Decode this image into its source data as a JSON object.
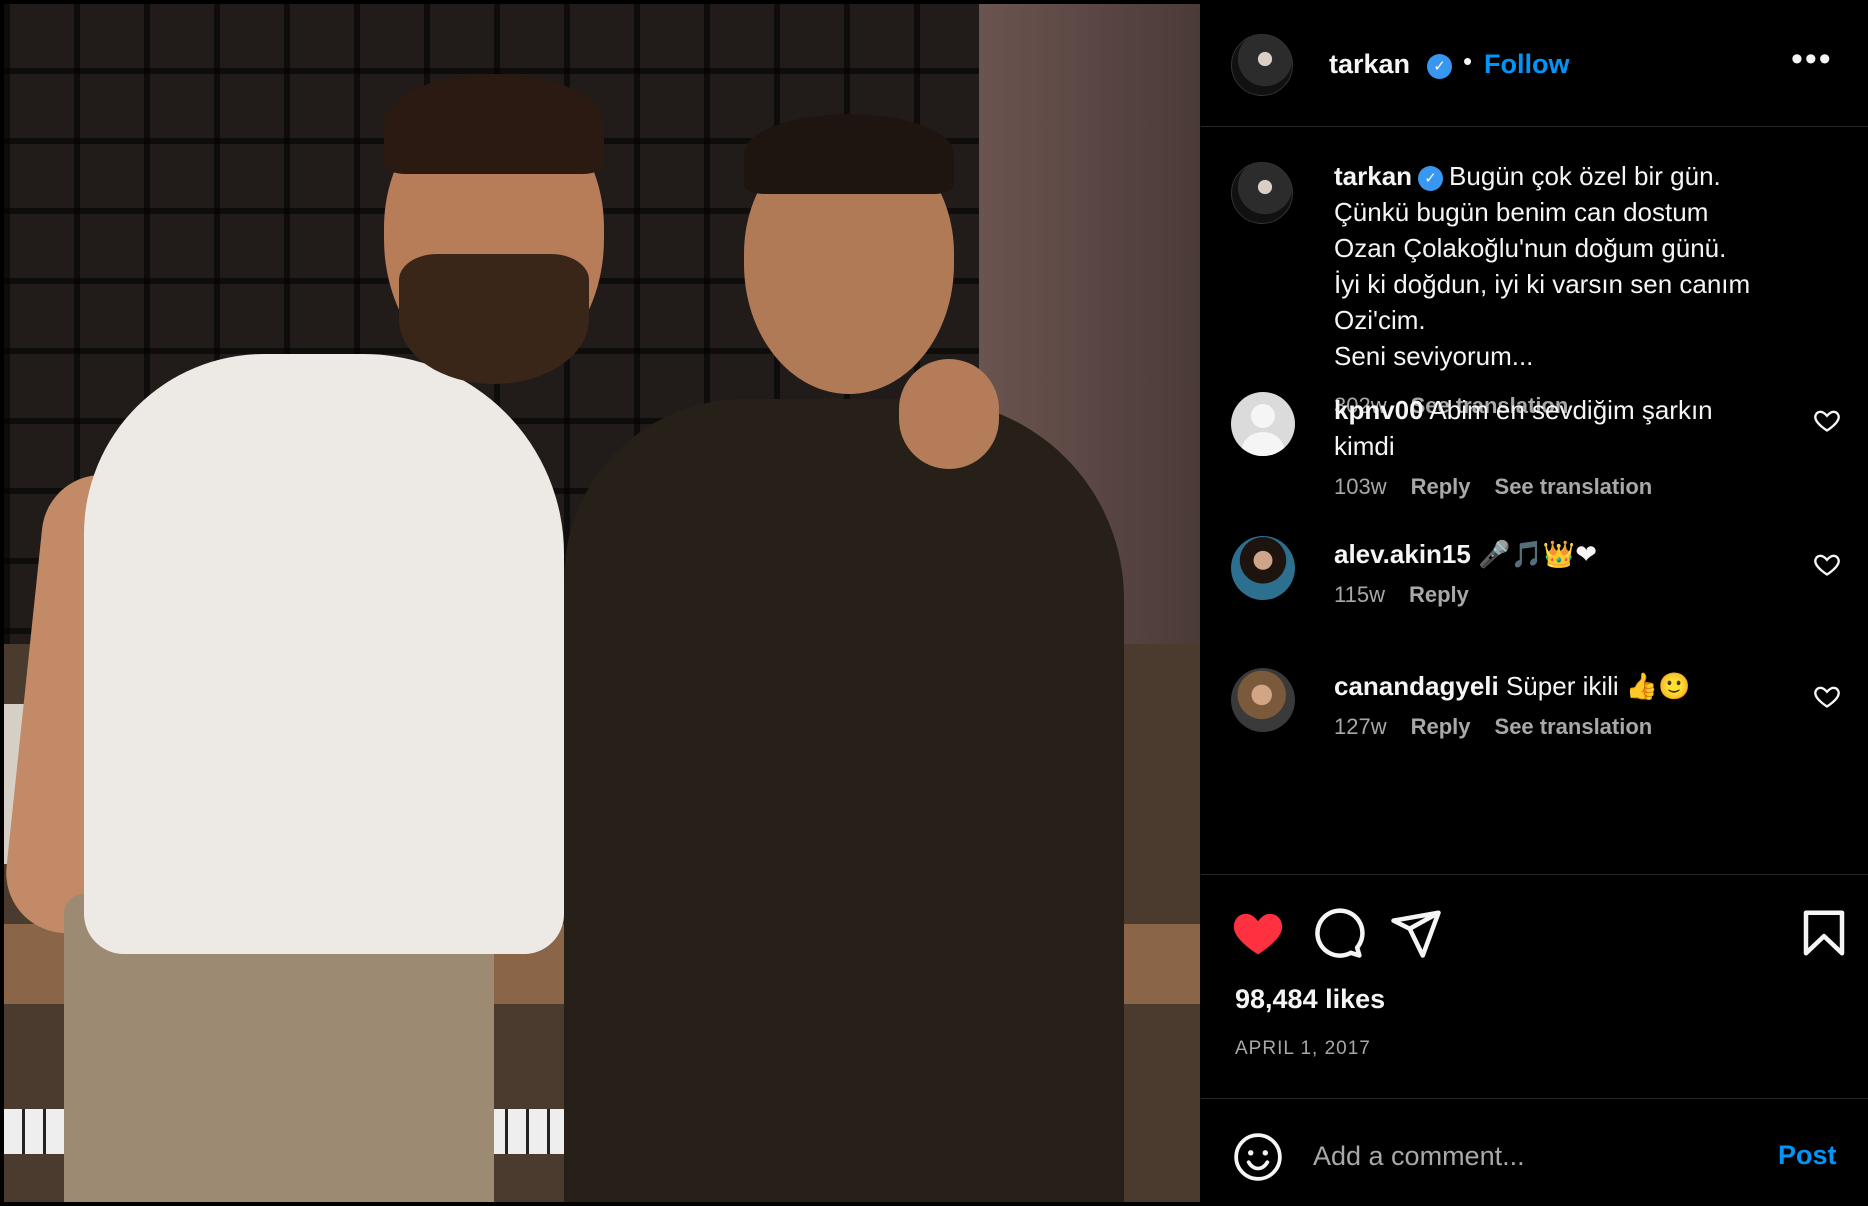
{
  "header": {
    "username": "tarkan",
    "verified_glyph": "✓",
    "separator": "•",
    "follow_label": "Follow",
    "more_label": "•••"
  },
  "caption": {
    "username": "tarkan",
    "lines": [
      "Bugün çok özel bir gün.",
      "Çünkü bugün benim can dostum",
      "Ozan Çolakoğlu'nun doğum günü.",
      "İyi ki doğdun, iyi ki varsın sen canım",
      "Ozi'cim.",
      "Seni seviyorum..."
    ],
    "time": "302w",
    "see_translation": "See translation"
  },
  "comments": [
    {
      "username": "kpnv00",
      "text": "Abim en sevdiğim şarkın kimdi",
      "time": "103w",
      "reply": "Reply",
      "see_translation": "See translation",
      "avatar": "default-avatar"
    },
    {
      "username": "alev.akin15",
      "text": "🎤🎵👑❤",
      "time": "115w",
      "reply": "Reply",
      "avatar": "user-photo"
    },
    {
      "username": "canandagyeli",
      "text": "Süper ikili 👍🙂",
      "time": "127w",
      "reply": "Reply",
      "see_translation": "See translation",
      "avatar": "user-photo"
    }
  ],
  "actions": {
    "like_icon": "heart-filled-icon",
    "comment_icon": "comment-icon",
    "share_icon": "share-icon",
    "save_icon": "bookmark-icon",
    "like_color": "#ff3040"
  },
  "likes": "98,484 likes",
  "date": "APRIL 1, 2017",
  "add_comment": {
    "placeholder": "Add a comment...",
    "post_label": "Post",
    "emoji_icon": "emoji-icon"
  },
  "colors": {
    "background": "#000000",
    "accent": "#0095f6",
    "muted": "#a8a8a8",
    "verified": "#3897f0"
  }
}
